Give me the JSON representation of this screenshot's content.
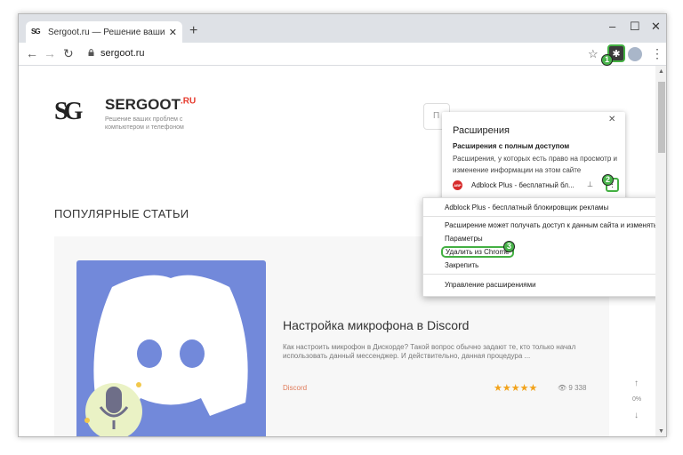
{
  "browser": {
    "tab_title": "Sergoot.ru — Решение ваших п",
    "tab_favicon": "SG",
    "url": "sergoot.ru"
  },
  "site": {
    "brand": "SERGOOT",
    "brand_suffix": ".RU",
    "tagline": "Решение ваших проблем с компьютером и телефоном",
    "search_placeholder": "П",
    "section_title": "ПОПУЛЯРНЫЕ СТАТЬИ",
    "article": {
      "title": "Настройка микрофона в Discord",
      "description": "Как настроить микрофон в Дискорде? Такой вопрос обычно задают те, кто только начал использовать данный мессенджер. И действительно, данная процедура ...",
      "category": "Discord",
      "stars": "★★★★★",
      "views": "9 338"
    },
    "scroll_percent": "0%"
  },
  "extensions_popup": {
    "title": "Расширения",
    "heading": "Расширения с полным доступом",
    "description": "Расширения, у которых есть право на просмотр и изменение информации на этом сайте",
    "extension_name": "Adblock Plus - бесплатный бл...",
    "extension_icon": "ABP"
  },
  "context_menu": {
    "header": "Adblock Plus - бесплатный блокировщик рекламы",
    "access": "Расширение может получать доступ к данным сайта и изменять их",
    "options": "Параметры",
    "remove": "Удалить из Chrome",
    "pin": "Закрепить",
    "manage": "Управление расширениями"
  },
  "annotations": {
    "step1": "1",
    "step2": "2",
    "step3": "3"
  },
  "colors": {
    "highlight": "#44b043",
    "discord": "#7289da",
    "brand_accent": "#e63b2e",
    "stars": "#f2a31b"
  }
}
